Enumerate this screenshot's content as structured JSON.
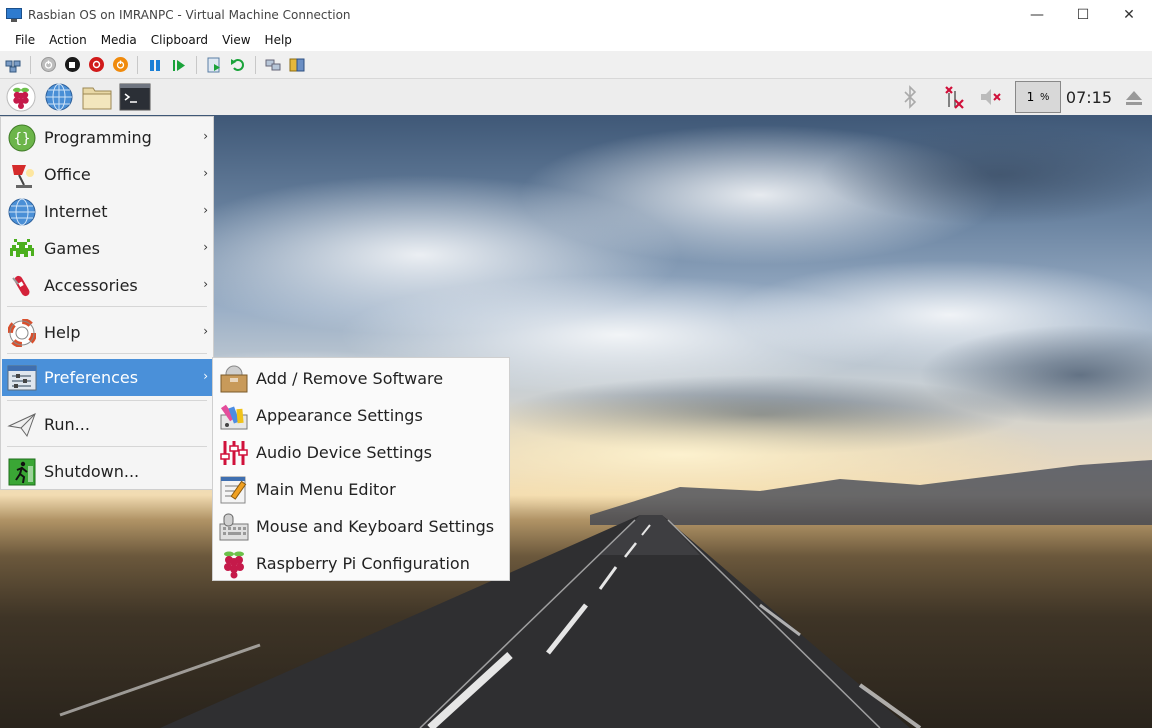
{
  "window": {
    "title": "Rasbian OS on IMRANPC - Virtual Machine Connection",
    "controls": {
      "minimize": "—",
      "maximize": "☐",
      "close": "✕"
    }
  },
  "menubar": [
    "File",
    "Action",
    "Media",
    "Clipboard",
    "View",
    "Help"
  ],
  "vm_toolbar": {
    "icons": [
      "ctrl-alt-del-icon",
      "start-icon",
      "turn-off-icon",
      "shutdown-icon",
      "save-icon",
      "pause-icon",
      "resume-icon",
      "checkpoint-icon",
      "revert-icon",
      "enhanced-session-icon",
      "share-icon"
    ]
  },
  "taskbar": {
    "cpu_value": "1",
    "cpu_unit": "%",
    "clock": "07:15"
  },
  "main_menu": {
    "items": [
      {
        "label": "Programming",
        "icon": "programming-icon",
        "has_submenu": true
      },
      {
        "label": "Office",
        "icon": "office-icon",
        "has_submenu": true
      },
      {
        "label": "Internet",
        "icon": "internet-icon",
        "has_submenu": true
      },
      {
        "label": "Games",
        "icon": "games-icon",
        "has_submenu": true
      },
      {
        "label": "Accessories",
        "icon": "accessories-icon",
        "has_submenu": true
      },
      {
        "label": "Help",
        "icon": "help-icon",
        "has_submenu": true
      },
      {
        "label": "Preferences",
        "icon": "preferences-icon",
        "has_submenu": true,
        "selected": true
      },
      {
        "label": "Run...",
        "icon": "run-icon",
        "has_submenu": false
      },
      {
        "label": "Shutdown...",
        "icon": "shutdown-icon",
        "has_submenu": false
      }
    ],
    "arrow": "›"
  },
  "preferences_submenu": {
    "items": [
      {
        "label": "Add / Remove Software",
        "icon": "package-icon"
      },
      {
        "label": "Appearance Settings",
        "icon": "appearance-icon"
      },
      {
        "label": "Audio Device Settings",
        "icon": "audio-mixer-icon"
      },
      {
        "label": "Main Menu Editor",
        "icon": "menu-editor-icon"
      },
      {
        "label": "Mouse and Keyboard Settings",
        "icon": "mouse-keyboard-icon"
      },
      {
        "label": "Raspberry Pi Configuration",
        "icon": "raspberry-icon"
      }
    ]
  },
  "colors": {
    "selection": "#4a90d9",
    "raspberry": "#c51a4a",
    "leaf": "#6cc04a"
  }
}
